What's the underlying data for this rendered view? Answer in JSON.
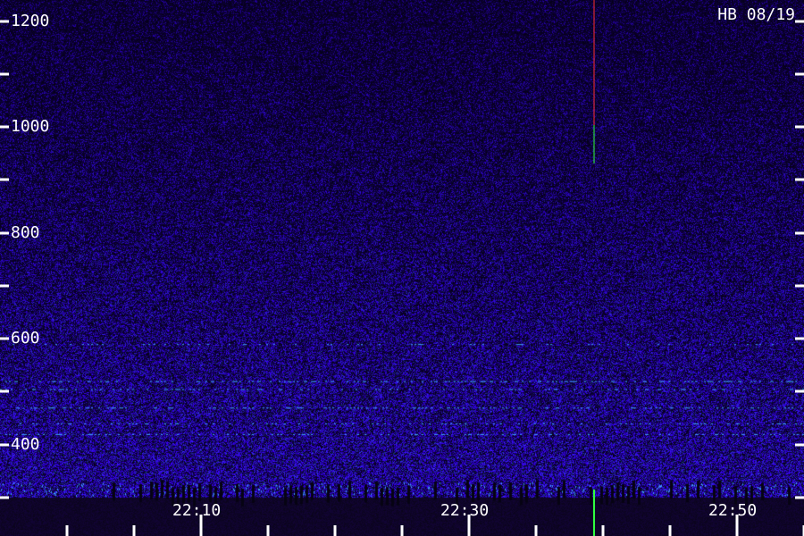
{
  "station_label": "HB 08/19",
  "y_axis": {
    "labels": [
      "1200",
      "1000",
      "800",
      "600",
      "400"
    ],
    "label_values": [
      1200,
      1000,
      800,
      600,
      400
    ],
    "tick_values": [
      1200,
      1100,
      1000,
      900,
      800,
      700,
      600,
      500,
      400,
      300
    ],
    "range": [
      300,
      1240
    ]
  },
  "x_axis": {
    "labels": [
      "22:10",
      "22:30",
      "22:50"
    ],
    "label_minutes": [
      10,
      30,
      50
    ],
    "tick_minutes": [
      0,
      5,
      10,
      15,
      20,
      25,
      30,
      35,
      40,
      45,
      50,
      55
    ],
    "range_minutes": [
      -5,
      55
    ]
  },
  "colors": {
    "background": "#0b0620",
    "noise": "#2a1aa8",
    "noise_bright": "#3a3ee0",
    "streak": "#3fa8ff",
    "tick": "#ffffff",
    "meteor_red": "#ff3030",
    "meteor_green": "#30ff40"
  },
  "meteor_minute": 39.3
}
